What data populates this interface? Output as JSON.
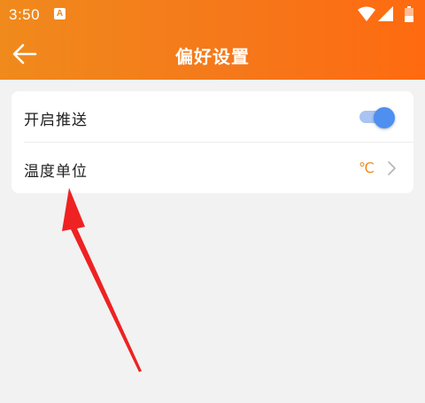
{
  "status_bar": {
    "time": "3:50",
    "app_icon_letter": "A"
  },
  "header": {
    "title": "偏好设置",
    "back_icon": "arrow-left-icon"
  },
  "settings": {
    "push": {
      "label": "开启推送",
      "enabled": true
    },
    "temperature_unit": {
      "label": "温度单位",
      "value": "℃",
      "chevron_icon": "chevron-right-icon"
    }
  },
  "colors": {
    "header_start": "#f08a1c",
    "header_end": "#ff6a10",
    "accent": "#f08a1c",
    "toggle_on": "#4e8ff0",
    "annotation_arrow": "#ee2222"
  }
}
